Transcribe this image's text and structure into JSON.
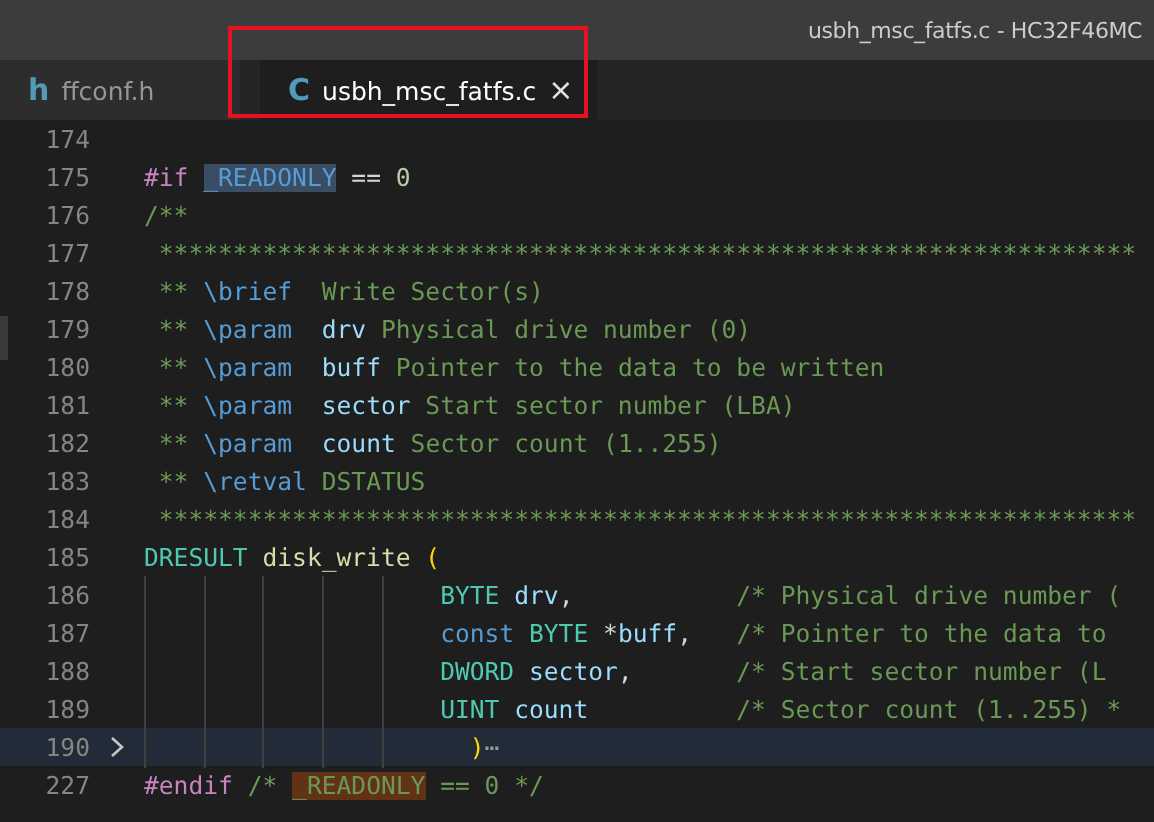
{
  "window": {
    "title": "usbh_msc_fatfs.c - HC32F46MC"
  },
  "tabs": [
    {
      "icon_text": "h",
      "label": "ffconf.h",
      "selected": false
    },
    {
      "icon_text": "C",
      "label": "usbh_msc_fatfs.c",
      "selected": true,
      "close_text": "×"
    }
  ],
  "editor": {
    "lines": [
      {
        "number": "174"
      },
      {
        "number": "175",
        "tokens": [
          {
            "kind": "preproc",
            "text": "#if "
          },
          {
            "kind": "macro_selected",
            "text": "_READONLY"
          },
          {
            "kind": "plain",
            "text": " == "
          },
          {
            "kind": "number",
            "text": "0"
          }
        ]
      },
      {
        "number": "176",
        "tokens": [
          {
            "kind": "comment",
            "text": "/**"
          }
        ]
      },
      {
        "number": "177",
        "tokens": [
          {
            "kind": "comment",
            "text": " ******************************************************************"
          }
        ]
      },
      {
        "number": "178",
        "tokens": [
          {
            "kind": "comment",
            "text": " ** "
          },
          {
            "kind": "doc_tag",
            "text": "\\brief"
          },
          {
            "kind": "comment",
            "text": "  Write Sector(s)"
          }
        ]
      },
      {
        "number": "179",
        "tokens": [
          {
            "kind": "comment",
            "text": " ** "
          },
          {
            "kind": "doc_tag",
            "text": "\\param  "
          },
          {
            "kind": "param",
            "text": "drv"
          },
          {
            "kind": "comment",
            "text": " Physical drive number (0)"
          }
        ]
      },
      {
        "number": "180",
        "tokens": [
          {
            "kind": "comment",
            "text": " ** "
          },
          {
            "kind": "doc_tag",
            "text": "\\param  "
          },
          {
            "kind": "param",
            "text": "buff"
          },
          {
            "kind": "comment",
            "text": " Pointer to the data to be written"
          }
        ]
      },
      {
        "number": "181",
        "tokens": [
          {
            "kind": "comment",
            "text": " ** "
          },
          {
            "kind": "doc_tag",
            "text": "\\param  "
          },
          {
            "kind": "param",
            "text": "sector"
          },
          {
            "kind": "comment",
            "text": " Start sector number (LBA)"
          }
        ]
      },
      {
        "number": "182",
        "tokens": [
          {
            "kind": "comment",
            "text": " ** "
          },
          {
            "kind": "doc_tag",
            "text": "\\param  "
          },
          {
            "kind": "param",
            "text": "count"
          },
          {
            "kind": "comment",
            "text": " Sector count (1..255)"
          }
        ]
      },
      {
        "number": "183",
        "tokens": [
          {
            "kind": "comment",
            "text": " ** "
          },
          {
            "kind": "doc_tag",
            "text": "\\retval"
          },
          {
            "kind": "comment",
            "text": " DSTATUS"
          }
        ]
      },
      {
        "number": "184",
        "tokens": [
          {
            "kind": "comment",
            "text": " ******************************************************************"
          }
        ]
      },
      {
        "number": "185",
        "tokens": [
          {
            "kind": "type",
            "text": "DRESULT "
          },
          {
            "kind": "func",
            "text": "disk_write "
          },
          {
            "kind": "paren",
            "text": "("
          }
        ]
      },
      {
        "number": "186",
        "tokens": [
          {
            "kind": "type",
            "text": "                    BYTE "
          },
          {
            "kind": "ident",
            "text": "drv"
          },
          {
            "kind": "plain",
            "text": ",           "
          },
          {
            "kind": "comment",
            "text": "/* Physical drive number ("
          }
        ]
      },
      {
        "number": "187",
        "tokens": [
          {
            "kind": "keyword",
            "text": "                    const "
          },
          {
            "kind": "type",
            "text": "BYTE "
          },
          {
            "kind": "plain",
            "text": "*"
          },
          {
            "kind": "ident",
            "text": "buff"
          },
          {
            "kind": "plain",
            "text": ",   "
          },
          {
            "kind": "comment",
            "text": "/* Pointer to the data to"
          }
        ]
      },
      {
        "number": "188",
        "tokens": [
          {
            "kind": "type",
            "text": "                    DWORD "
          },
          {
            "kind": "ident",
            "text": "sector"
          },
          {
            "kind": "plain",
            "text": ",       "
          },
          {
            "kind": "comment",
            "text": "/* Start sector number (L"
          }
        ]
      },
      {
        "number": "189",
        "tokens": [
          {
            "kind": "type",
            "text": "                    UINT "
          },
          {
            "kind": "ident",
            "text": "count"
          },
          {
            "kind": "comment",
            "text": "          /* Sector count (1..255) *"
          }
        ]
      },
      {
        "number": "190",
        "folded": true,
        "current": true,
        "tokens": [
          {
            "kind": "paren",
            "text": "                      )"
          },
          {
            "kind": "fold_ellipsis",
            "text": "⋯"
          }
        ]
      },
      {
        "number": "227",
        "tokens": [
          {
            "kind": "preproc",
            "text": "#endif "
          },
          {
            "kind": "comment",
            "text": "/* "
          },
          {
            "kind": "macro_match",
            "text": "_READONLY"
          },
          {
            "kind": "comment",
            "text": " == 0 */"
          }
        ]
      }
    ]
  }
}
